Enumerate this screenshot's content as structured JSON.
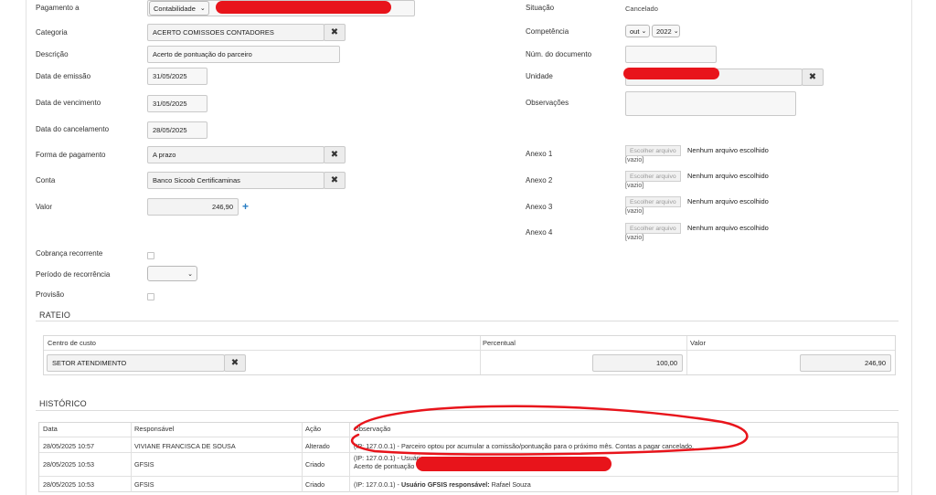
{
  "left_form": {
    "pagamento_a": {
      "label": "Pagamento a",
      "select_value": "Contabilidade"
    },
    "categoria": {
      "label": "Categoria",
      "value": "ACERTO COMISSOES CONTADORES"
    },
    "descricao": {
      "label": "Descrição",
      "value": "Acerto de pontuação do parceiro"
    },
    "data_emissao": {
      "label": "Data de emissão",
      "value": "31/05/2025"
    },
    "data_vencimento": {
      "label": "Data de vencimento",
      "value": "31/05/2025"
    },
    "data_cancelamento": {
      "label": "Data do cancelamento",
      "value": "28/05/2025"
    },
    "forma_pagamento": {
      "label": "Forma de pagamento",
      "value": "A prazo"
    },
    "conta": {
      "label": "Conta",
      "value": "Banco Sicoob Certificaminas"
    },
    "valor": {
      "label": "Valor",
      "value": "246,90"
    },
    "cobranca_recorrente": {
      "label": "Cobrança recorrente",
      "checked": false
    },
    "periodo_recorrencia": {
      "label": "Período de recorrência",
      "value": ""
    },
    "provisao": {
      "label": "Provisão",
      "checked": false
    }
  },
  "right_form": {
    "situacao": {
      "label": "Situação",
      "value": "Cancelado"
    },
    "competencia": {
      "label": "Competência",
      "month": "out",
      "year": "2022"
    },
    "num_documento": {
      "label": "Núm. do documento",
      "value": ""
    },
    "unidade": {
      "label": "Unidade",
      "value": ""
    },
    "observacoes": {
      "label": "Observações",
      "value": ""
    },
    "anexos": [
      {
        "label": "Anexo 1",
        "button": "Escolher arquivo",
        "status": "Nenhum arquivo escolhido",
        "note": "[vazio]"
      },
      {
        "label": "Anexo 2",
        "button": "Escolher arquivo",
        "status": "Nenhum arquivo escolhido",
        "note": "[vazio]"
      },
      {
        "label": "Anexo 3",
        "button": "Escolher arquivo",
        "status": "Nenhum arquivo escolhido",
        "note": "[vazio]"
      },
      {
        "label": "Anexo 4",
        "button": "Escolher arquivo",
        "status": "Nenhum arquivo escolhido",
        "note": "[vazio]"
      }
    ]
  },
  "rateio": {
    "title": "RATEIO",
    "headers": {
      "centro": "Centro de custo",
      "percentual": "Percentual",
      "valor": "Valor"
    },
    "row": {
      "centro": "SETOR ATENDIMENTO",
      "percentual": "100,00",
      "valor": "246,90"
    }
  },
  "historico": {
    "title": "HISTÓRICO",
    "headers": {
      "data": "Data",
      "responsavel": "Responsável",
      "acao": "Ação",
      "observacao": "Observação"
    },
    "rows": [
      {
        "data": "28/05/2025 10:57",
        "responsavel": "VIVIANE FRANCISCA DE SOUSA",
        "acao": "Alterado",
        "obs_prefix": "(IP: ",
        "obs_ip": "127.0.0.1",
        "obs_text": ") - Parceiro optou por acumular a comissão/pontuação para o próximo mês. Contas a pagar cancelado."
      },
      {
        "data": "28/05/2025 10:53",
        "responsavel": "GFSIS",
        "acao": "Criado",
        "obs_line1": "(IP: 127.0.0.1) - Usuário",
        "obs_line2": "Acerto de pontuação"
      },
      {
        "data": "28/05/2025 10:53",
        "responsavel": "GFSIS",
        "acao": "Criado",
        "obs_prefix": "(IP: 127.0.0.1) - ",
        "obs_bold": "Usuário GFSIS responsável:",
        "obs_name": " Rafael Souza"
      }
    ]
  },
  "icons": {
    "clear": "times-icon",
    "add": "plus-icon",
    "dropdown": "chevron-down-icon"
  },
  "colors": {
    "accent": "#2a7ec4",
    "redaction": "#e8141b"
  }
}
